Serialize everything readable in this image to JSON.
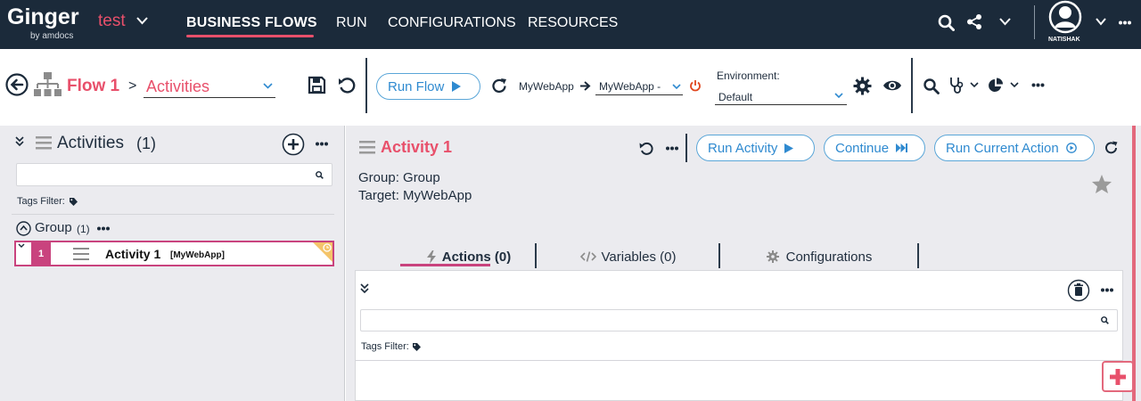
{
  "topbar": {
    "brand": "Ginger",
    "brand_sub": "by amdocs",
    "solution": "test",
    "nav": [
      "BUSINESS FLOWS",
      "RUN",
      "CONFIGURATIONS",
      "RESOURCES"
    ],
    "username": "NATISHAK"
  },
  "toolbar": {
    "flow_name": "Flow 1",
    "breadcrumb_sep": ">",
    "view_select": "Activities",
    "run_flow": "Run Flow",
    "source_app": "MyWebApp",
    "target_app": "MyWebApp -",
    "environment_label": "Environment:",
    "environment_value": "Default"
  },
  "activities_panel": {
    "title": "Activities",
    "count": "(1)",
    "search_placeholder": "",
    "tags_filter": "Tags Filter:",
    "group_name": "Group",
    "group_count": "(1)",
    "activity": {
      "index": "1",
      "name": "Activity 1",
      "target": "[MyWebApp]"
    }
  },
  "activity_detail": {
    "title": "Activity 1",
    "run_activity": "Run Activity",
    "continue": "Continue",
    "run_current_action": "Run Current Action",
    "group_line": "Group: Group",
    "target_line": "Target: MyWebApp",
    "tabs": [
      "Actions (0)",
      "Variables (0)",
      "Configurations"
    ],
    "actions_tags_filter": "Tags Filter:"
  },
  "colors": {
    "topbar_bg": "#1b2a3a",
    "accent": "#e8506b",
    "link_blue": "#2f8ad0",
    "panel_bg": "#ebebef"
  }
}
